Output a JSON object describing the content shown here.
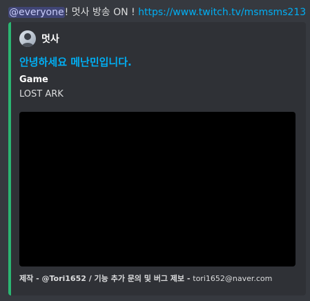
{
  "message": {
    "mention": "@everyone",
    "text": "! 멋사 방송 ON ! ",
    "link": "https://www.twitch.tv/msmsms213"
  },
  "embed": {
    "color": "#2bb673",
    "author": {
      "name": "멋사",
      "avatar_icon": "avatar-icon"
    },
    "title": "안녕하세요 메난민입니다.",
    "fields": [
      {
        "name": "Game",
        "value": "LOST ARK"
      }
    ],
    "image_alt": "stream-preview-image",
    "footer": {
      "text": "제작 - @Tori1652 / 기능 추가 문의 및 버그 제보 - ",
      "email": "tori1652@naver.com"
    }
  }
}
